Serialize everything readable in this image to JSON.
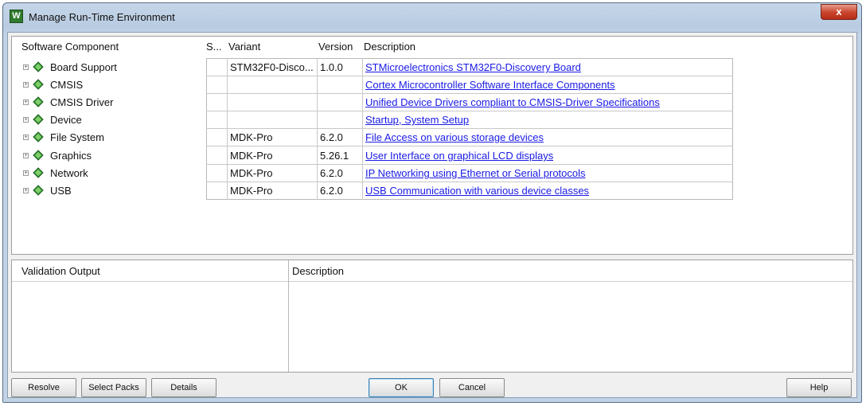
{
  "window": {
    "title": "Manage Run-Time Environment",
    "app_icon_letter": "W",
    "close_symbol": "x"
  },
  "components": {
    "headers": {
      "software_component": "Software Component",
      "sel": "S...",
      "variant": "Variant",
      "version": "Version",
      "description": "Description"
    },
    "rows": [
      {
        "name": "Board Support",
        "variant": "STM32F0-Disco...",
        "version": "1.0.0",
        "description": "STMicroelectronics STM32F0-Discovery Board"
      },
      {
        "name": "CMSIS",
        "variant": "",
        "version": "",
        "description": "Cortex Microcontroller Software Interface Components"
      },
      {
        "name": "CMSIS Driver",
        "variant": "",
        "version": "",
        "description": "Unified Device Drivers compliant to CMSIS-Driver Specifications"
      },
      {
        "name": "Device",
        "variant": "",
        "version": "",
        "description": "Startup, System Setup"
      },
      {
        "name": "File System",
        "variant": "MDK-Pro",
        "version": "6.2.0",
        "description": "File Access on various storage devices"
      },
      {
        "name": "Graphics",
        "variant": "MDK-Pro",
        "version": "5.26.1",
        "description": "User Interface on graphical LCD displays"
      },
      {
        "name": "Network",
        "variant": "MDK-Pro",
        "version": "6.2.0",
        "description": "IP Networking using Ethernet or Serial protocols"
      },
      {
        "name": "USB",
        "variant": "MDK-Pro",
        "version": "6.2.0",
        "description": "USB Communication with various device classes"
      }
    ],
    "expander_symbol": "+",
    "gem_color": "#3a9a3a"
  },
  "validation": {
    "output_header": "Validation Output",
    "description_header": "Description"
  },
  "buttons": {
    "resolve": "Resolve",
    "select_packs": "Select Packs",
    "details": "Details",
    "ok": "OK",
    "cancel": "Cancel",
    "help": "Help"
  },
  "colors": {
    "link": "#1a1ae6",
    "close_button": "#c9432c"
  }
}
